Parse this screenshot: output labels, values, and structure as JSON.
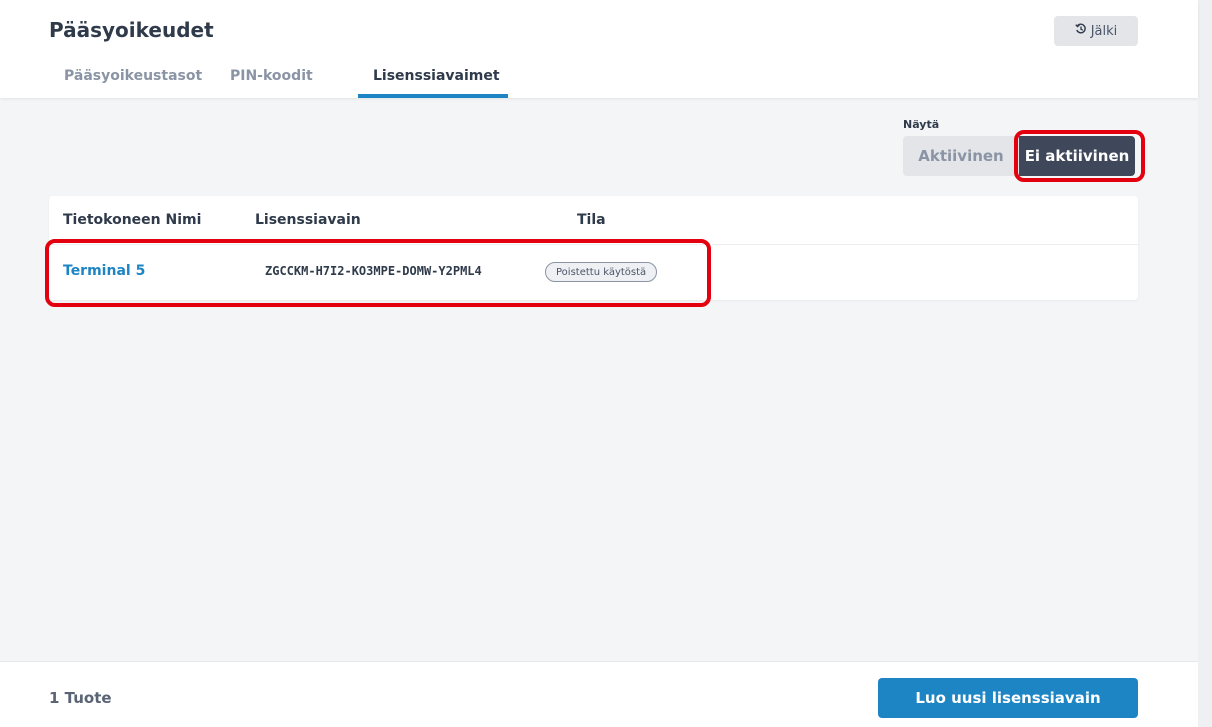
{
  "header": {
    "title": "Pääsyoikeudet",
    "history_label": "Jälki",
    "history_icon": "history-icon"
  },
  "tabs": [
    {
      "label": "Pääsyoikeustasot",
      "active": false
    },
    {
      "label": "PIN-koodit",
      "active": false
    },
    {
      "label": "Lisenssiavaimet",
      "active": true
    }
  ],
  "filter": {
    "label": "Näytä",
    "options": [
      "Aktiivinen",
      "Ei aktiivinen"
    ],
    "selected": "Ei aktiivinen"
  },
  "table": {
    "columns": [
      "Tietokoneen Nimi",
      "Lisenssiavain",
      "Tila"
    ],
    "rows": [
      {
        "name": "Terminal 5",
        "key": "ZGCCKM-H7I2-KO3MPE-DOMW-Y2PML4",
        "status": "Poistettu käytöstä"
      }
    ]
  },
  "footer": {
    "count": "1 Tuote",
    "create_label": "Luo uusi lisenssiavain"
  },
  "colors": {
    "accent": "#1d85c4",
    "toggle_selected": "#3f475a",
    "highlight": "#e3000f"
  }
}
